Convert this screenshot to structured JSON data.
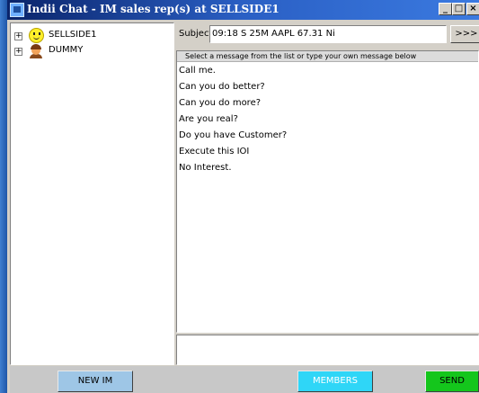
{
  "window": {
    "title": "Indii Chat - IM sales rep(s) at SELLSIDE1",
    "controls": {
      "minimize": "_",
      "maximize": "□",
      "close": "×"
    }
  },
  "tree": {
    "items": [
      {
        "label": "SELLSIDE1",
        "icon": "smiley-icon",
        "expander": "+"
      },
      {
        "label": "DUMMY",
        "icon": "person-icon",
        "expander": "+"
      }
    ]
  },
  "subject": {
    "label": "Subject:",
    "value": "09:18 S 25M AAPL 67.31 Ni",
    "more_label": ">>>"
  },
  "messages": {
    "header": "Select a message from the list or type your own message below",
    "items": [
      "Call me.",
      "Can you do better?",
      "Can you do more?",
      "Are you real?",
      "Do you have Customer?",
      "Execute this IOI",
      "No Interest."
    ]
  },
  "compose": {
    "value": ""
  },
  "buttons": {
    "new_im": "NEW IM",
    "members": "MEMBERS",
    "send": "SEND"
  },
  "colors": {
    "titlebar": "#0a246a",
    "new_im_button": "#9ec6e6",
    "members_button": "#2fd6f7",
    "send_button": "#14c61c"
  }
}
